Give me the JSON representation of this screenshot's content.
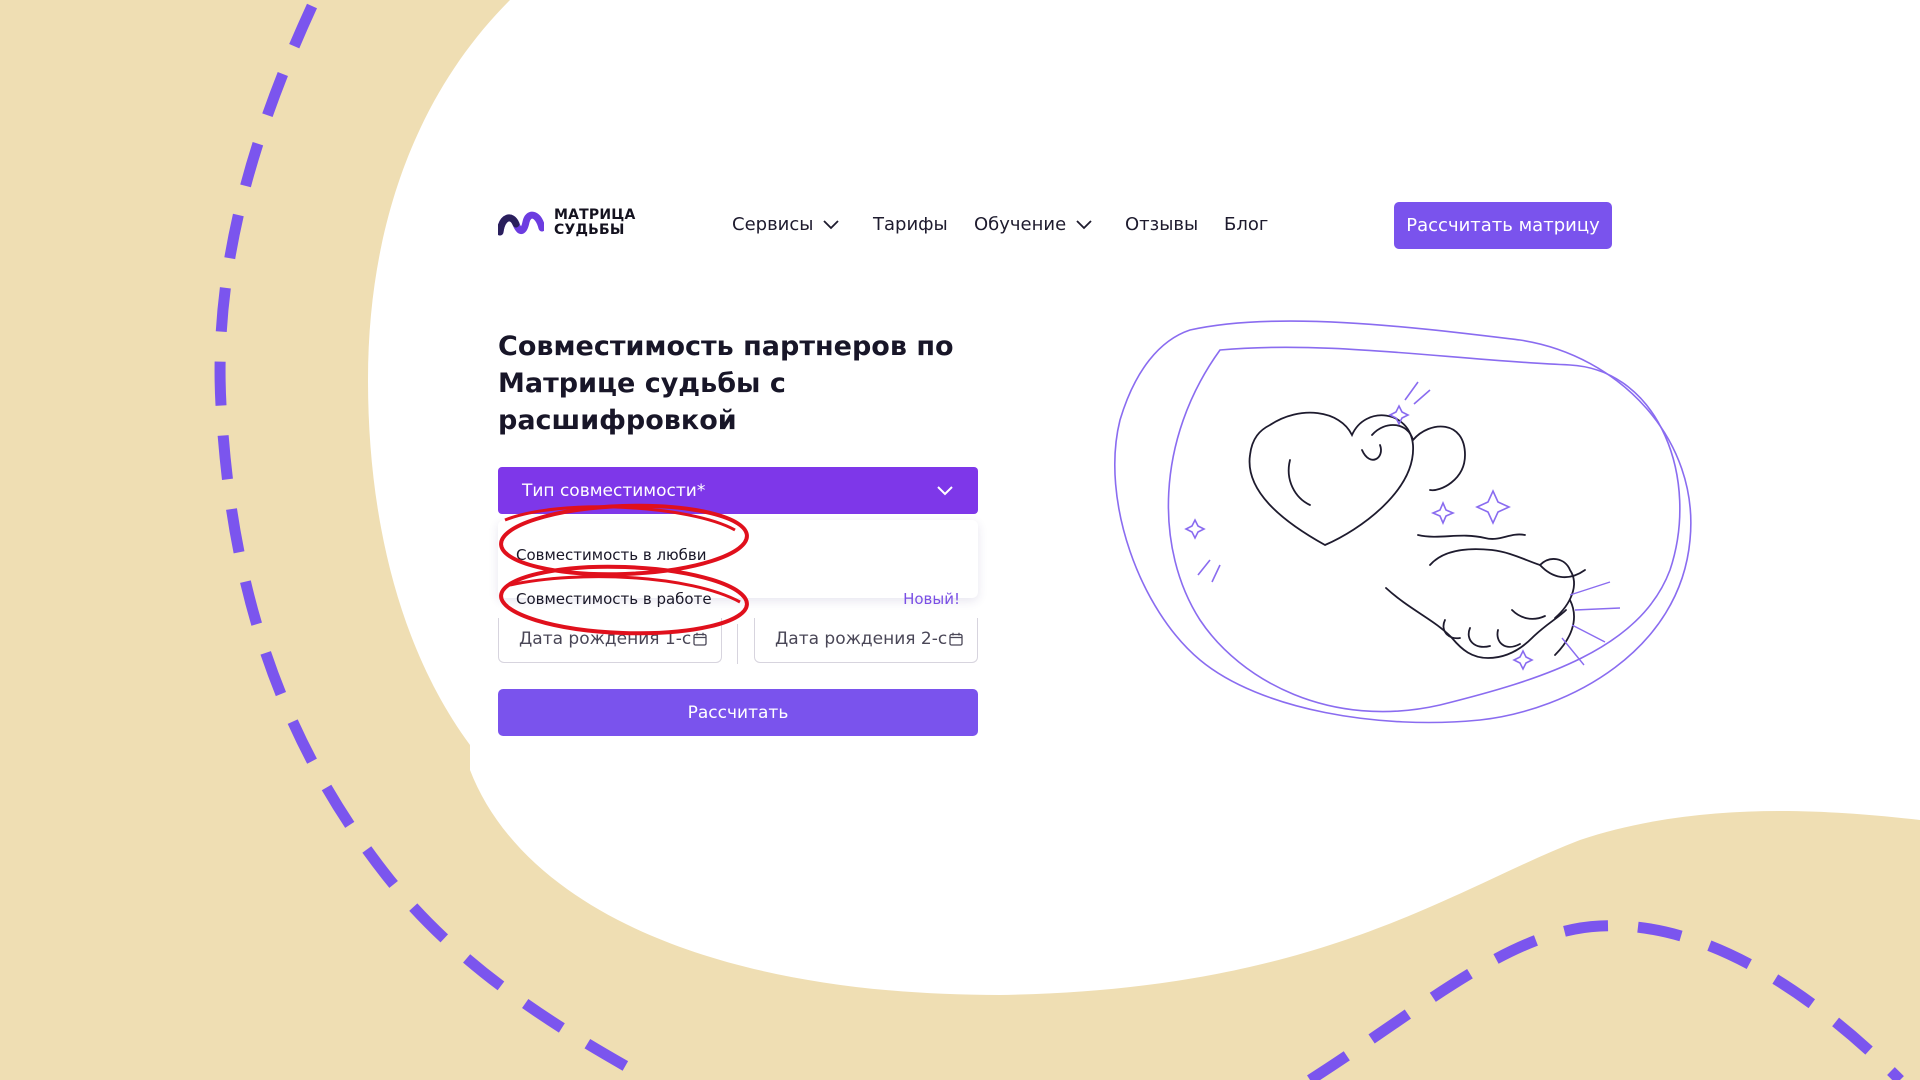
{
  "logo": {
    "line1": "МАТРИЦА",
    "line2": "СУДЬБЫ"
  },
  "nav": {
    "services": "Сервисы",
    "tariffs": "Тарифы",
    "education": "Обучение",
    "reviews": "Отзывы",
    "blog": "Блог"
  },
  "cta_top": "Рассчитать матрицу",
  "title": "Совместимость партнеров по Матрице судьбы с расшифровкой",
  "form": {
    "select_label": "Тип совместимости*",
    "options": [
      {
        "label": "Совместимость в любви"
      },
      {
        "label": "Совместимость в работе",
        "badge": "Новый!"
      }
    ],
    "date1": "Дата рождения 1-с",
    "date2": "Дата рождения 2-с",
    "submit": "Рассчитать"
  },
  "colors": {
    "accent": "#7a53ed",
    "select_bg": "#7e37e9",
    "background": "#efdeb3",
    "annotation": "#e0101c"
  }
}
